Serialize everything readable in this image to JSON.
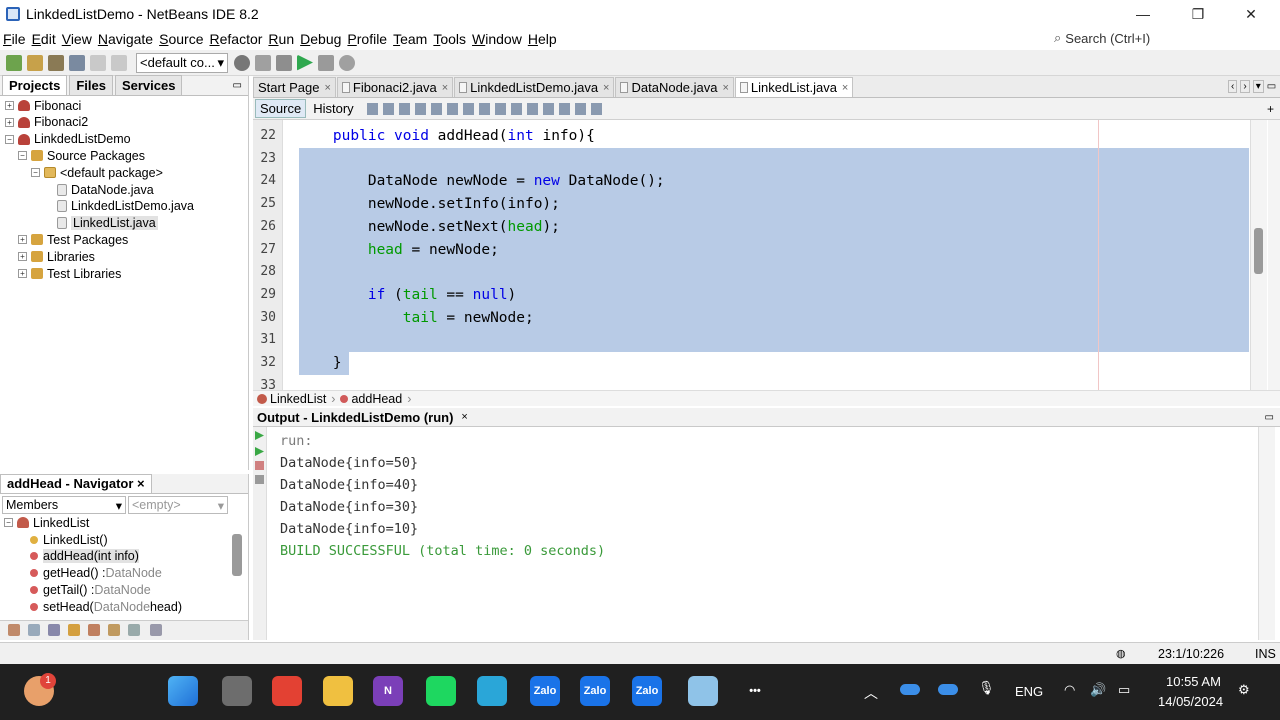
{
  "window": {
    "title": "LinkdedListDemo - NetBeans IDE 8.2",
    "minimize": "—",
    "maximize": "❐",
    "close": "✕"
  },
  "menu": [
    "File",
    "Edit",
    "View",
    "Navigate",
    "Source",
    "Refactor",
    "Run",
    "Debug",
    "Profile",
    "Team",
    "Tools",
    "Window",
    "Help"
  ],
  "search": {
    "placeholder": "Search (Ctrl+I)"
  },
  "toolbar": {
    "config": "<default co...",
    "config_arrow": "▾"
  },
  "projects": {
    "tabs": [
      "Projects",
      "Files",
      "Services"
    ],
    "tree": [
      {
        "label": "Fibonaci",
        "level": 0,
        "icon": "project",
        "exp": "+"
      },
      {
        "label": "Fibonaci2",
        "level": 0,
        "icon": "project",
        "exp": "+"
      },
      {
        "label": "LinkdedListDemo",
        "level": 0,
        "icon": "project",
        "exp": "−"
      },
      {
        "label": "Source Packages",
        "level": 1,
        "icon": "package",
        "exp": "−"
      },
      {
        "label": "<default package>",
        "level": 2,
        "icon": "default-package",
        "exp": "−"
      },
      {
        "label": "DataNode.java",
        "level": 3,
        "icon": "java"
      },
      {
        "label": "LinkdedListDemo.java",
        "level": 3,
        "icon": "java"
      },
      {
        "label": "LinkedList.java",
        "level": 3,
        "icon": "java",
        "selected": true
      },
      {
        "label": "Test Packages",
        "level": 1,
        "icon": "package",
        "exp": "+"
      },
      {
        "label": "Libraries",
        "level": 1,
        "icon": "package",
        "exp": "+"
      },
      {
        "label": "Test Libraries",
        "level": 1,
        "icon": "package",
        "exp": "+"
      }
    ]
  },
  "navigator": {
    "title": "addHead - Navigator",
    "close": "×",
    "filter": "Members",
    "filter2": "<empty>",
    "root": "LinkedList",
    "members": [
      {
        "name": "LinkedList()",
        "type": "",
        "kind": "constructor"
      },
      {
        "name": "addHead(int info)",
        "type": "",
        "kind": "method",
        "selected": true
      },
      {
        "name": "getHead() : ",
        "type": "DataNode",
        "kind": "method"
      },
      {
        "name": "getTail() : ",
        "type": "DataNode",
        "kind": "method"
      },
      {
        "name": "setHead(",
        "type": "DataNode",
        "suffix": " head)",
        "kind": "method"
      }
    ]
  },
  "editor": {
    "tabs": [
      {
        "label": "Start Page",
        "close": "×",
        "active": false
      },
      {
        "label": "Fibonaci2.java",
        "close": "×",
        "active": false
      },
      {
        "label": "LinkdedListDemo.java",
        "close": "×",
        "active": false
      },
      {
        "label": "DataNode.java",
        "close": "×",
        "active": false
      },
      {
        "label": "LinkedList.java",
        "close": "×",
        "active": true
      }
    ],
    "subtabs": [
      "Source",
      "History"
    ],
    "lines": [
      {
        "num": "22",
        "segments": [
          {
            "t": "    "
          },
          {
            "t": "public void",
            "c": "kw"
          },
          {
            "t": " addHead("
          },
          {
            "t": "int",
            "c": "kw"
          },
          {
            "t": " info){"
          }
        ]
      },
      {
        "num": "23",
        "segments": [
          {
            "t": ""
          }
        ]
      },
      {
        "num": "24",
        "segments": [
          {
            "t": "        DataNode newNode = "
          },
          {
            "t": "new",
            "c": "kw"
          },
          {
            "t": " DataNode();"
          }
        ]
      },
      {
        "num": "25",
        "segments": [
          {
            "t": "        newNode.setInfo(info);"
          }
        ]
      },
      {
        "num": "26",
        "segments": [
          {
            "t": "        newNode.setNext("
          },
          {
            "t": "head",
            "c": "fld"
          },
          {
            "t": ");"
          }
        ]
      },
      {
        "num": "27",
        "segments": [
          {
            "t": "        "
          },
          {
            "t": "head",
            "c": "fld"
          },
          {
            "t": " = newNode;"
          }
        ]
      },
      {
        "num": "28",
        "segments": [
          {
            "t": ""
          }
        ]
      },
      {
        "num": "29",
        "segments": [
          {
            "t": "        "
          },
          {
            "t": "if",
            "c": "kw"
          },
          {
            "t": " ("
          },
          {
            "t": "tail",
            "c": "fld"
          },
          {
            "t": " == "
          },
          {
            "t": "null",
            "c": "kw"
          },
          {
            "t": ")"
          }
        ]
      },
      {
        "num": "30",
        "segments": [
          {
            "t": "            "
          },
          {
            "t": "tail",
            "c": "fld"
          },
          {
            "t": " = newNode;"
          }
        ]
      },
      {
        "num": "31",
        "segments": [
          {
            "t": ""
          }
        ]
      },
      {
        "num": "32",
        "segments": [
          {
            "t": "    }"
          }
        ]
      },
      {
        "num": "33",
        "segments": [
          {
            "t": ""
          }
        ]
      }
    ],
    "breadcrumb": [
      "LinkedList",
      "addHead"
    ]
  },
  "output": {
    "title": "Output - LinkdedListDemo (run)",
    "close": "×",
    "lines": [
      {
        "text": "run:",
        "color": "#7a7a7a"
      },
      {
        "text": "DataNode{info=50}",
        "color": "#333333"
      },
      {
        "text": "DataNode{info=40}",
        "color": "#333333"
      },
      {
        "text": "DataNode{info=30}",
        "color": "#333333"
      },
      {
        "text": "DataNode{info=10}",
        "color": "#333333"
      },
      {
        "text": "BUILD SUCCESSFUL (total time: 0 seconds)",
        "color": "#3a9a3a"
      }
    ]
  },
  "status": {
    "position": "23:1/10:226",
    "mode": "INS"
  },
  "taskbar": {
    "badge": "1",
    "lang": "ENG",
    "time": "10:55 AM",
    "date": "14/05/2024",
    "apps": [
      {
        "name": "windows-start-icon",
        "label": "",
        "color": "#3b8ee8"
      },
      {
        "name": "task-view-icon",
        "label": "",
        "color": "#6d6d6d"
      },
      {
        "name": "chrome-icon",
        "label": "",
        "color": "#e34133"
      },
      {
        "name": "file-explorer-icon",
        "label": "",
        "color": "#f0c040"
      },
      {
        "name": "onenote-icon",
        "label": "N",
        "color": "#7b3fb8"
      },
      {
        "name": "spotify-icon",
        "label": "",
        "color": "#1ed760"
      },
      {
        "name": "aperture-app-icon",
        "label": "",
        "color": "#2aa6d8"
      },
      {
        "name": "zalo-icon",
        "label": "Zalo",
        "color": "#1a73e8"
      },
      {
        "name": "zalo-icon-2",
        "label": "Zalo",
        "color": "#1a73e8"
      },
      {
        "name": "zalo-icon-3",
        "label": "Zalo",
        "color": "#1a73e8"
      },
      {
        "name": "netbeans-icon",
        "label": "",
        "color": "#8fc3e8"
      },
      {
        "name": "more-apps-icon",
        "label": "•••",
        "color": "transparent"
      }
    ]
  }
}
